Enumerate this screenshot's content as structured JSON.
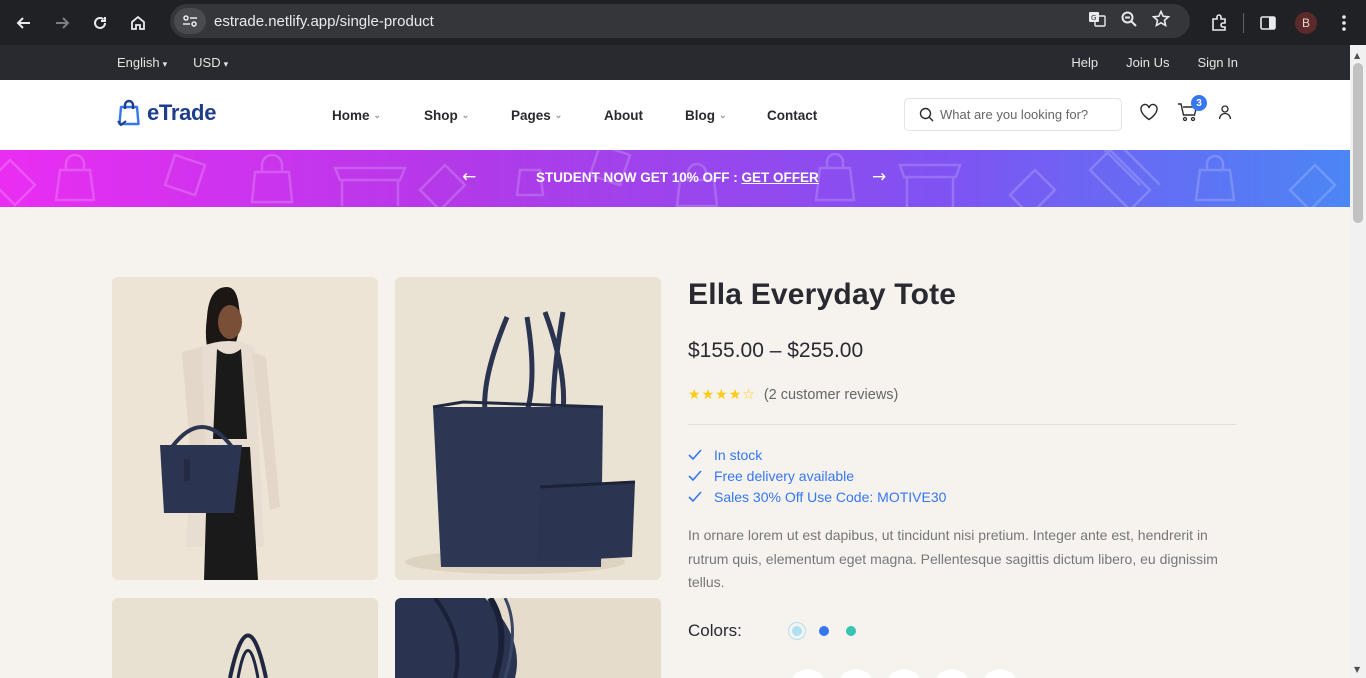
{
  "browser": {
    "url": "estrade.netlify.app/single-product",
    "profile_initial": "B"
  },
  "topbar": {
    "language": "English",
    "currency": "USD",
    "links": [
      "Help",
      "Join Us",
      "Sign In"
    ]
  },
  "header": {
    "logo_text": "eTrade",
    "nav": [
      {
        "label": "Home",
        "dropdown": true
      },
      {
        "label": "Shop",
        "dropdown": true
      },
      {
        "label": "Pages",
        "dropdown": true
      },
      {
        "label": "About",
        "dropdown": false
      },
      {
        "label": "Blog",
        "dropdown": true
      },
      {
        "label": "Contact",
        "dropdown": false
      }
    ],
    "search_placeholder": "What are you looking for?",
    "cart_count": "3"
  },
  "promo": {
    "text": "STUDENT NOW GET 10% OFF : ",
    "link": "GET OFFER"
  },
  "product": {
    "title": "Ella Everyday Tote",
    "price": "$155.00 – $255.00",
    "rating": 4,
    "rating_max": 5,
    "reviews": "(2 customer reviews)",
    "features": [
      "In stock",
      "Free delivery available",
      "Sales 30% Off Use Code: MOTIVE30"
    ],
    "description": "In ornare lorem ut est dapibus, ut tincidunt nisi pretium. Integer ante est, hendrerit in rutrum quis, elementum eget magna. Pellentesque sagittis dictum libero, eu dignissim tellus.",
    "colors_label": "Colors:",
    "colors": [
      "#aee1f2",
      "#3577f0",
      "#36c4b3"
    ]
  }
}
